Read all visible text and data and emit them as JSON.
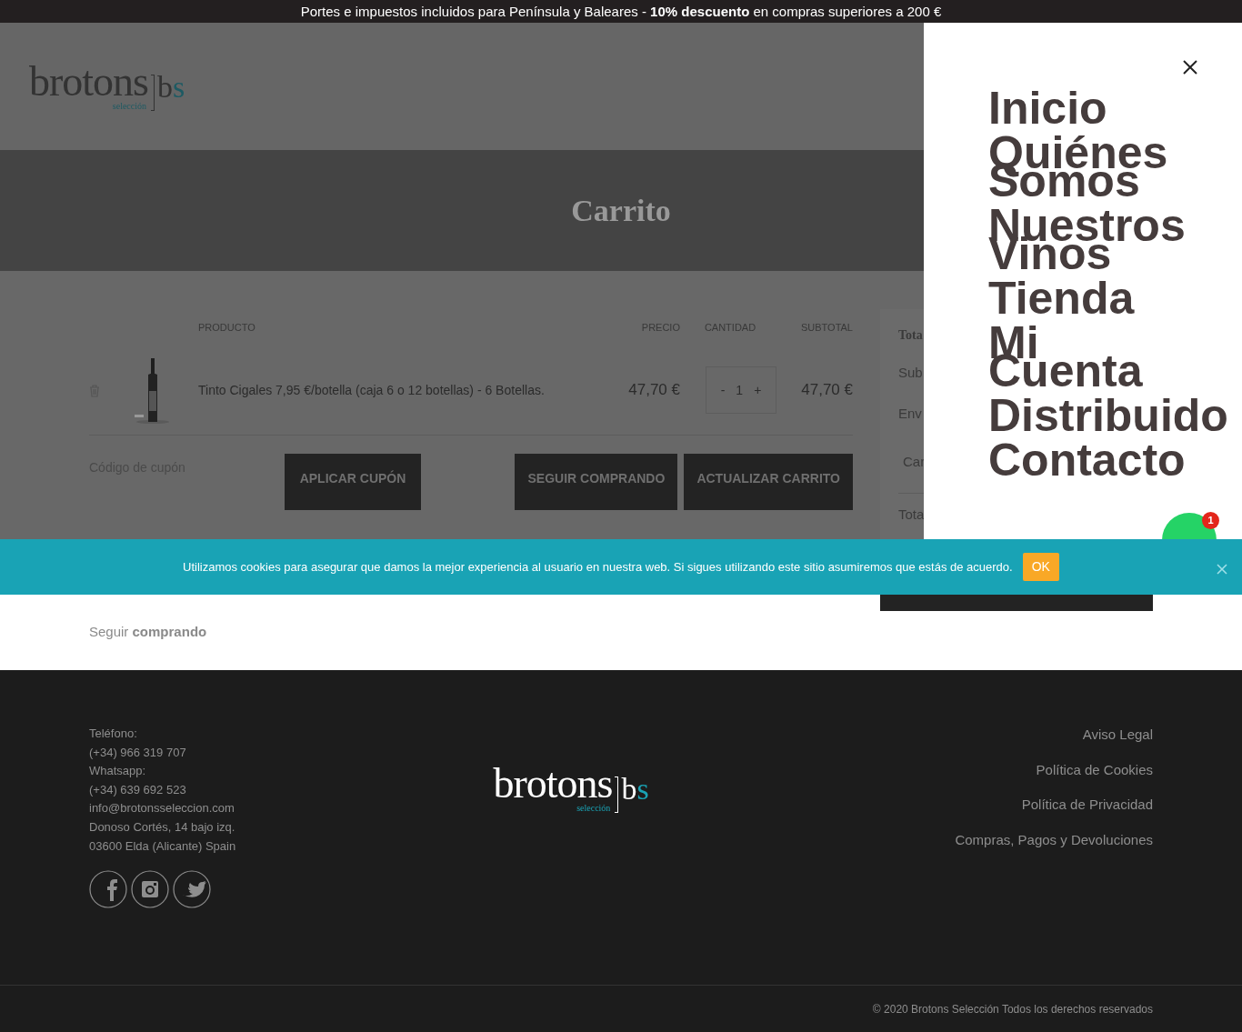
{
  "announcement": "Portes e impuestos incluidos para Península y Baleares - **10% descuento** en compras superiores a 200 €",
  "header": {
    "logo": {
      "word": "brotons",
      "sub": "selección",
      "mark": "bs"
    }
  },
  "page_title": "Carrito",
  "cart": {
    "columns": [
      "PRODUCTO",
      "PRECIO",
      "CANTIDAD",
      "SUBTOTAL"
    ],
    "items": [
      {
        "name": "Tinto Cigales 7,95 €/botella (caja 6 o 12 botellas) - 6 Botellas.",
        "price": "47,70 €",
        "minus": "-",
        "quantity": "1",
        "plus": "+",
        "subtotal": "47,70 €"
      }
    ],
    "coupon": {
      "placeholder": "Código de cupón",
      "apply": "APLICAR CUPÓN"
    },
    "buttons": [
      "SEGUIR COMPRANDO",
      "ACTUALIZAR CARRITO"
    ]
  },
  "totals": {
    "heading": "Tota",
    "rows": [
      "Sub",
      "Env",
      "Car"
    ],
    "total": "Tota"
  },
  "continue_link": "Seguir **comprando**",
  "side_menu": {
    "items": [
      "Inicio",
      "Quiénes Somos",
      "Nuestros Vinos",
      "Tienda",
      "Mi Cuenta",
      "Distribuido",
      "Contacto"
    ]
  },
  "chat": {
    "badge": "1"
  },
  "cookie_notice": {
    "text": "Utilizamos cookies para asegurar que damos la mejor experiencia al usuario en nuestra web. Si sigues utilizando este sitio asumiremos que estás de acuerdo.",
    "ok": "OK"
  },
  "footer": {
    "contact": [
      "Teléfono:",
      "(+34) 966 319 707",
      "Whatsapp:",
      "(+34) 639 692 523",
      "info@brotonsseleccion.com",
      "Donoso Cortés, 14 bajo izq.",
      "03600 Elda (Alicante) Spain"
    ],
    "logo": {
      "word": "brotons",
      "sub": "selección",
      "mark": "bs"
    },
    "links": [
      "Aviso Legal",
      "Política de Cookies",
      "Política de Privacidad",
      "Compras, Pagos y Devoluciones"
    ],
    "copyright": "© 2020 Brotons Selección Todos los derechos reservados"
  }
}
